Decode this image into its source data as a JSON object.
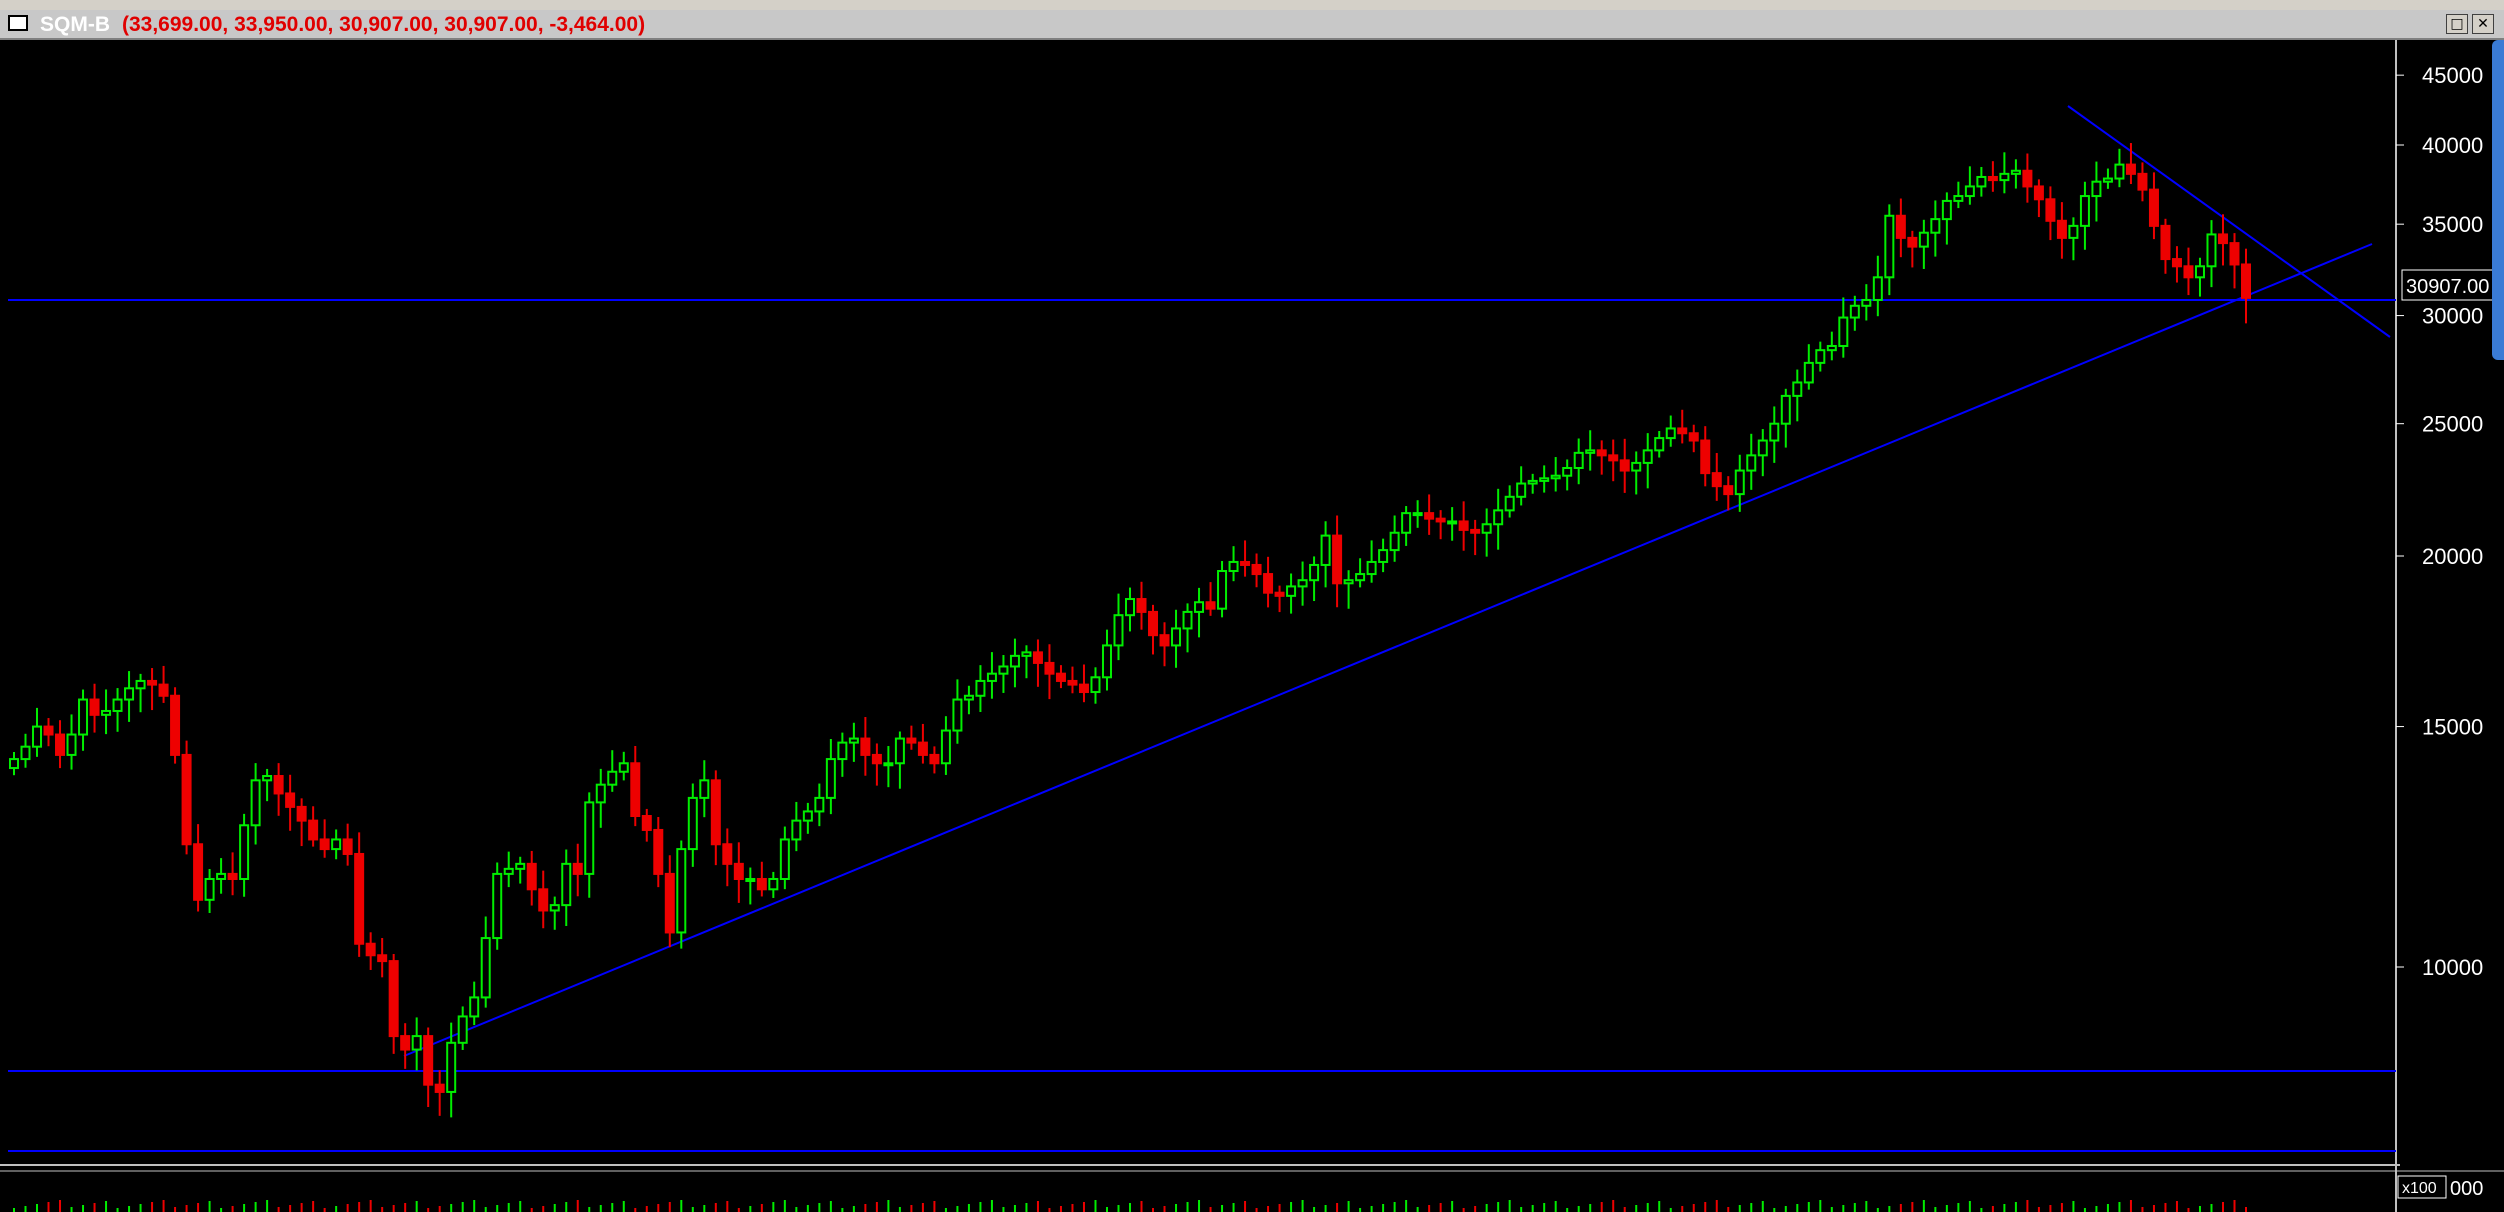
{
  "window": {
    "symbol": "SQM-B",
    "ohlc_text": "(33,699.00, 33,950.00, 30,907.00, 30,907.00, -3,464.00)",
    "buttons": {
      "restore": "□",
      "close": "✕"
    }
  },
  "colors": {
    "background": "#000000",
    "up_candle": "#00ee00",
    "down_candle": "#ee0000",
    "trendline": "#0000ff",
    "axis_text": "#ffffff",
    "title_text": "#e00000"
  },
  "chart_data": {
    "type": "candlestick",
    "scale": "log",
    "ylim": [
      7300,
      46000
    ],
    "y_ticks": [
      10000,
      15000,
      20000,
      25000,
      30000,
      35000,
      40000,
      45000
    ],
    "y_tick_labels": [
      "10000",
      "15000",
      "20000",
      "25000",
      "30000",
      "35000",
      "40000",
      "45000"
    ],
    "last_price_label": "30907.00",
    "volume_axis_label": "x100",
    "volume_tick_label": "000",
    "closes": [
      14200,
      14500,
      15000,
      14800,
      14300,
      14800,
      15700,
      15300,
      15400,
      15700,
      16000,
      16200,
      16100,
      15800,
      14300,
      12300,
      11200,
      11600,
      11700,
      11600,
      12700,
      13700,
      13800,
      13400,
      13100,
      12800,
      12400,
      12200,
      12400,
      12100,
      10400,
      10200,
      10100,
      8900,
      8700,
      8900,
      8200,
      8100,
      8800,
      9200,
      9500,
      10500,
      11700,
      11800,
      11900,
      11400,
      11000,
      11100,
      11900,
      11700,
      13200,
      13600,
      13900,
      14100,
      12900,
      12600,
      11700,
      10600,
      12200,
      13300,
      13700,
      12300,
      11900,
      11600,
      11600,
      11400,
      11600,
      12400,
      12800,
      13000,
      13300,
      14200,
      14600,
      14700,
      14300,
      14100,
      14100,
      14700,
      14600,
      14300,
      14100,
      14900,
      15700,
      15800,
      16200,
      16400,
      16600,
      16900,
      17000,
      16700,
      16400,
      16200,
      16100,
      15900,
      16300,
      17200,
      18100,
      18600,
      18200,
      17500,
      17200,
      17700,
      18200,
      18500,
      18300,
      19500,
      19800,
      19700,
      19400,
      18800,
      18700,
      19000,
      19200,
      19700,
      20700,
      19100,
      19200,
      19400,
      19800,
      20200,
      20800,
      21500,
      21500,
      21300,
      21200,
      21200,
      20900,
      20800,
      21100,
      21600,
      22100,
      22600,
      22700,
      22800,
      22900,
      23200,
      23800,
      23900,
      23700,
      23500,
      23100,
      23400,
      23900,
      24400,
      24800,
      24600,
      24300,
      23000,
      22500,
      22200,
      23100,
      23700,
      24300,
      25000,
      26200,
      26800,
      27700,
      28300,
      28500,
      29900,
      30500,
      30800,
      32000,
      35500,
      34200,
      33700,
      34500,
      35300,
      36400,
      36700,
      37300,
      37900,
      37700,
      38100,
      38300,
      37300,
      36500,
      35200,
      34200,
      34900,
      36700,
      37600,
      37800,
      38700,
      38100,
      37100,
      34900,
      33000,
      32600,
      32000,
      32600,
      34400,
      33900,
      32700,
      30907
    ]
  }
}
